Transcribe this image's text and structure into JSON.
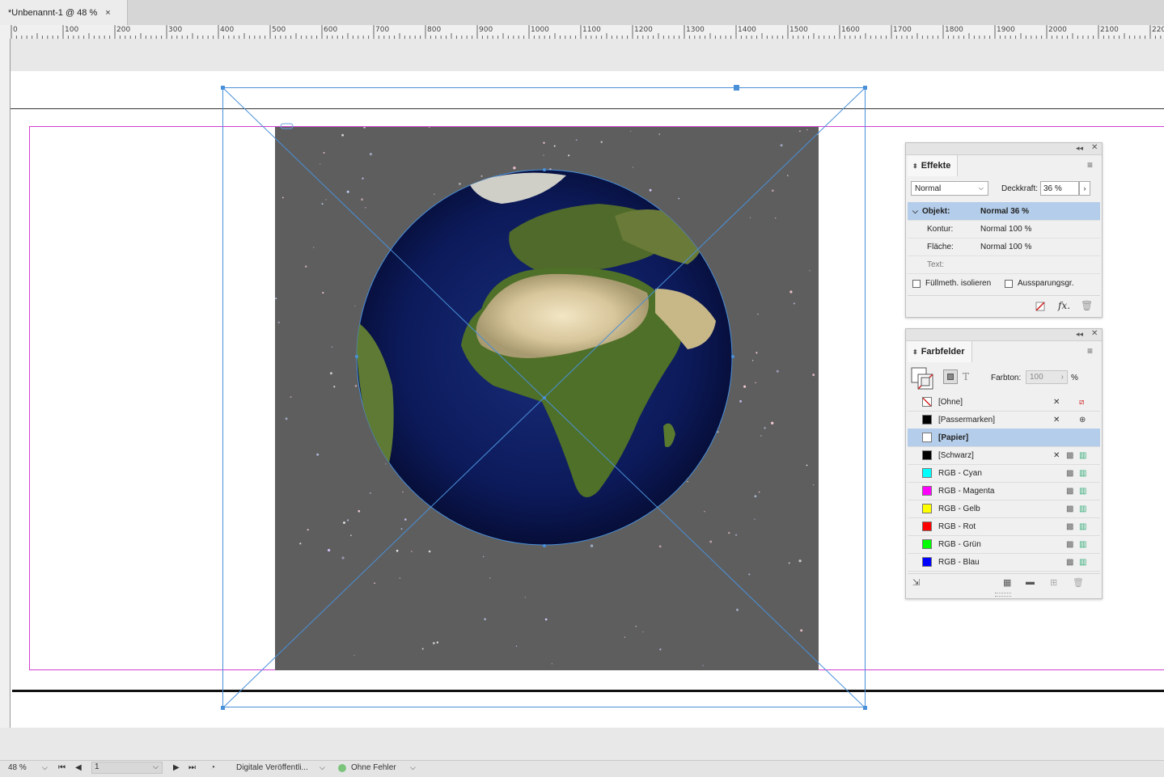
{
  "document_tab": {
    "title": "*Unbenannt-1 @ 48 %",
    "close_glyph": "×"
  },
  "ruler": {
    "labels": [
      "0",
      "100",
      "200",
      "300",
      "400",
      "500",
      "600",
      "700",
      "800",
      "900",
      "1000",
      "1100",
      "1200",
      "1300",
      "1400",
      "1500",
      "1600",
      "1700",
      "1800",
      "1900",
      "2000",
      "2100",
      "220"
    ]
  },
  "effects_panel": {
    "title": "Effekte",
    "blend_mode": "Normal",
    "opacity_label": "Deckkraft:",
    "opacity_value": "36 %",
    "rows": [
      {
        "label": "Objekt:",
        "value": "Normal 36 %",
        "selected": true
      },
      {
        "label": "Kontur:",
        "value": "Normal 100 %"
      },
      {
        "label": "Fläche:",
        "value": "Normal 100 %"
      },
      {
        "label": "Text:",
        "value": ""
      }
    ],
    "isolate_label": "Füllmeth. isolieren",
    "knockout_label": "Aussparungsgr.",
    "fx_label": "fx."
  },
  "swatches_panel": {
    "title": "Farbfelder",
    "tint_label": "Farbton:",
    "tint_value": "100",
    "tint_unit": "%",
    "text_glyph": "T",
    "swatches": [
      {
        "name": "[Ohne]",
        "color": "none"
      },
      {
        "name": "[Passermarken]",
        "color": "#000000"
      },
      {
        "name": "[Papier]",
        "color": "#ffffff",
        "selected": true
      },
      {
        "name": "[Schwarz]",
        "color": "#000000"
      },
      {
        "name": "RGB - Cyan",
        "color": "#00ffff"
      },
      {
        "name": "RGB - Magenta",
        "color": "#ff00ff"
      },
      {
        "name": "RGB - Gelb",
        "color": "#ffff00"
      },
      {
        "name": "RGB - Rot",
        "color": "#ff0000"
      },
      {
        "name": "RGB - Grün",
        "color": "#00ff00"
      },
      {
        "name": "RGB - Blau",
        "color": "#0000ff"
      }
    ]
  },
  "statusbar": {
    "zoom": "48 %",
    "page": "1",
    "preflight_profile": "Digitale Veröffentli...",
    "preflight_status": "Ohne Fehler",
    "status_color": "#7cc47c"
  },
  "colors": {
    "selection": "#4a90d9",
    "margin_guide": "#d040d0"
  }
}
